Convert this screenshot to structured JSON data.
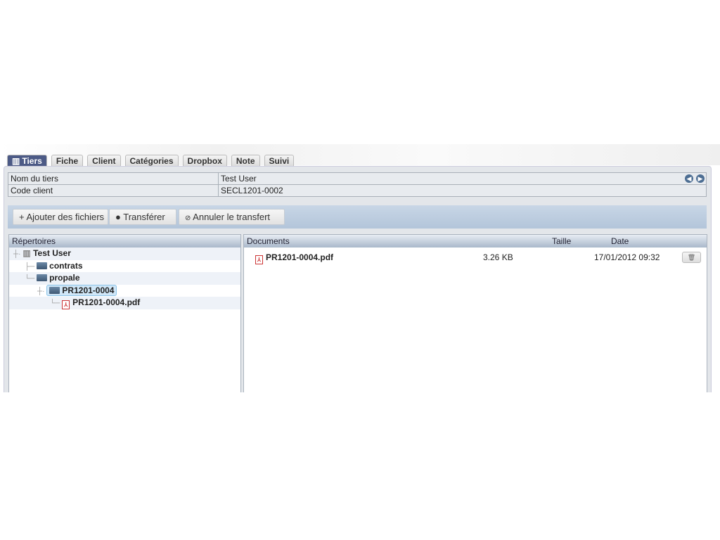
{
  "tabs": [
    {
      "label": "Tiers",
      "active": true
    },
    {
      "label": "Fiche"
    },
    {
      "label": "Client"
    },
    {
      "label": "Catégories"
    },
    {
      "label": "Dropbox"
    },
    {
      "label": "Note"
    },
    {
      "label": "Suivi"
    }
  ],
  "info": {
    "name_label": "Nom du tiers",
    "name_value": "Test User",
    "code_label": "Code client",
    "code_value": "SECL1201-0002"
  },
  "toolbar": {
    "add": "Ajouter des fichiers",
    "transfer": "Transférer",
    "cancel": "Annuler le transfert"
  },
  "tree": {
    "header": "Répertoires",
    "root": "Test User",
    "contrats": "contrats",
    "propale": "propale",
    "folder": "PR1201-0004",
    "file": "PR1201-0004.pdf"
  },
  "documents": {
    "header": "Documents",
    "size_header": "Taille",
    "date_header": "Date",
    "rows": [
      {
        "name": "PR1201-0004.pdf",
        "size": "3.26 KB",
        "date": "17/01/2012 09:32"
      }
    ]
  }
}
